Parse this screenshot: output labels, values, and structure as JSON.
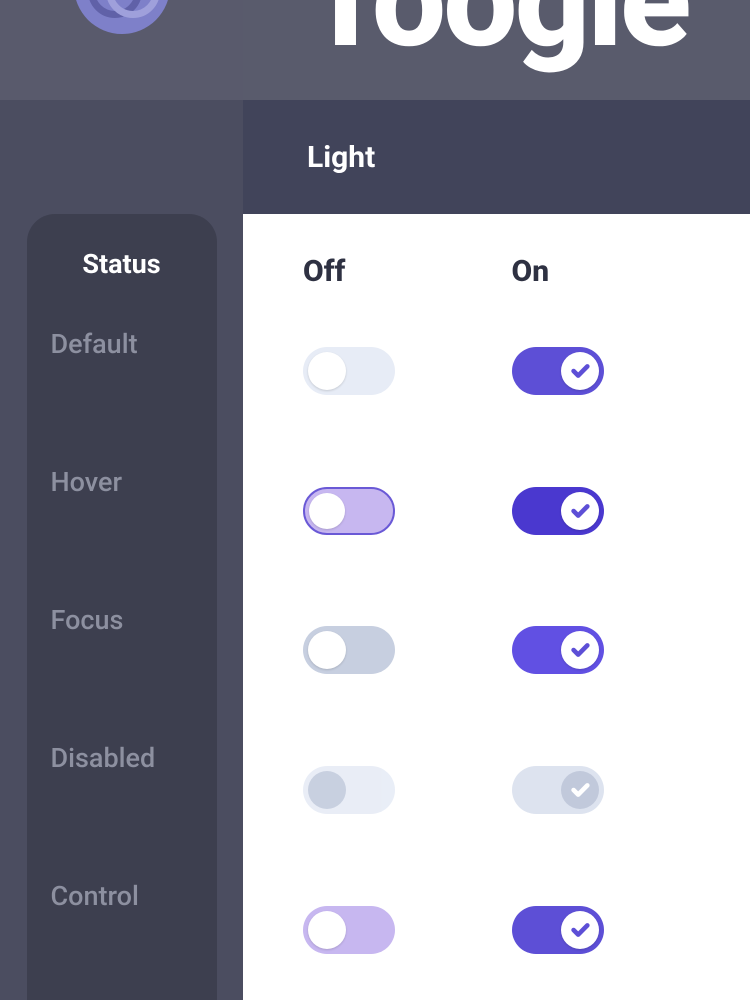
{
  "hero_title": "Toogle",
  "theme": {
    "label": "Light"
  },
  "sidebar": {
    "title": "Status",
    "rows": [
      "Default",
      "Hover",
      "Focus",
      "Disabled",
      "Control"
    ]
  },
  "columns": {
    "off": "Off",
    "on": "On"
  },
  "colors": {
    "accent": "#5d4fd6",
    "accent_dark": "#4a38cf",
    "accent_light": "#c7b7f0",
    "track_off": "#e7ecf6",
    "focus_track": "#c7cfe0",
    "halo": "#e9e8f8",
    "disabled_knob": "#c3cbdd",
    "disabled_on_track": "#dde3ef",
    "panel_bg": "#4b4d60",
    "card_bg": "#3d3f4f",
    "theme_bar": "#41445a",
    "text_muted": "#8d90a0",
    "text_strong": "#2e3142"
  }
}
